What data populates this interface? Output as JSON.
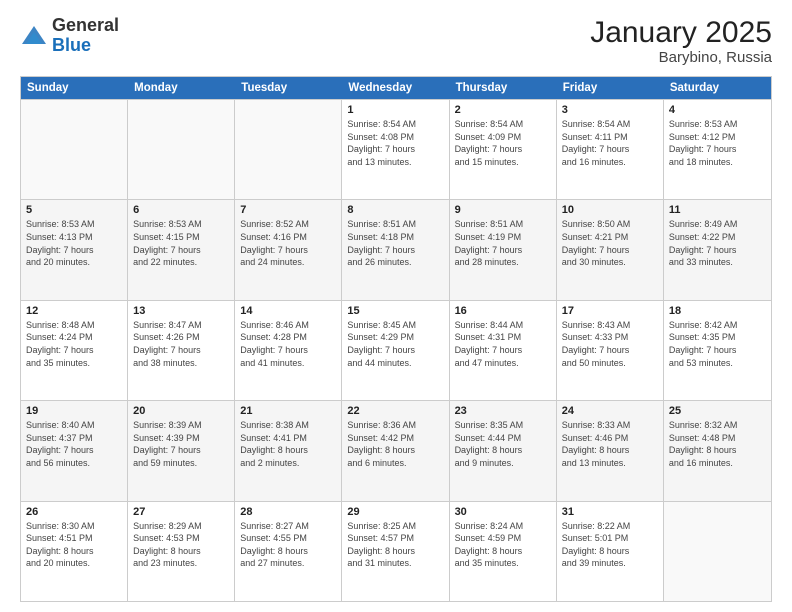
{
  "logo": {
    "general": "General",
    "blue": "Blue"
  },
  "title": "January 2025",
  "subtitle": "Barybino, Russia",
  "weekdays": [
    "Sunday",
    "Monday",
    "Tuesday",
    "Wednesday",
    "Thursday",
    "Friday",
    "Saturday"
  ],
  "rows": [
    [
      {
        "day": "",
        "info": "",
        "empty": true
      },
      {
        "day": "",
        "info": "",
        "empty": true
      },
      {
        "day": "",
        "info": "",
        "empty": true
      },
      {
        "day": "1",
        "info": "Sunrise: 8:54 AM\nSunset: 4:08 PM\nDaylight: 7 hours\nand 13 minutes.",
        "empty": false
      },
      {
        "day": "2",
        "info": "Sunrise: 8:54 AM\nSunset: 4:09 PM\nDaylight: 7 hours\nand 15 minutes.",
        "empty": false
      },
      {
        "day": "3",
        "info": "Sunrise: 8:54 AM\nSunset: 4:11 PM\nDaylight: 7 hours\nand 16 minutes.",
        "empty": false
      },
      {
        "day": "4",
        "info": "Sunrise: 8:53 AM\nSunset: 4:12 PM\nDaylight: 7 hours\nand 18 minutes.",
        "empty": false
      }
    ],
    [
      {
        "day": "5",
        "info": "Sunrise: 8:53 AM\nSunset: 4:13 PM\nDaylight: 7 hours\nand 20 minutes.",
        "empty": false,
        "alt": true
      },
      {
        "day": "6",
        "info": "Sunrise: 8:53 AM\nSunset: 4:15 PM\nDaylight: 7 hours\nand 22 minutes.",
        "empty": false,
        "alt": true
      },
      {
        "day": "7",
        "info": "Sunrise: 8:52 AM\nSunset: 4:16 PM\nDaylight: 7 hours\nand 24 minutes.",
        "empty": false,
        "alt": true
      },
      {
        "day": "8",
        "info": "Sunrise: 8:51 AM\nSunset: 4:18 PM\nDaylight: 7 hours\nand 26 minutes.",
        "empty": false,
        "alt": true
      },
      {
        "day": "9",
        "info": "Sunrise: 8:51 AM\nSunset: 4:19 PM\nDaylight: 7 hours\nand 28 minutes.",
        "empty": false,
        "alt": true
      },
      {
        "day": "10",
        "info": "Sunrise: 8:50 AM\nSunset: 4:21 PM\nDaylight: 7 hours\nand 30 minutes.",
        "empty": false,
        "alt": true
      },
      {
        "day": "11",
        "info": "Sunrise: 8:49 AM\nSunset: 4:22 PM\nDaylight: 7 hours\nand 33 minutes.",
        "empty": false,
        "alt": true
      }
    ],
    [
      {
        "day": "12",
        "info": "Sunrise: 8:48 AM\nSunset: 4:24 PM\nDaylight: 7 hours\nand 35 minutes.",
        "empty": false
      },
      {
        "day": "13",
        "info": "Sunrise: 8:47 AM\nSunset: 4:26 PM\nDaylight: 7 hours\nand 38 minutes.",
        "empty": false
      },
      {
        "day": "14",
        "info": "Sunrise: 8:46 AM\nSunset: 4:28 PM\nDaylight: 7 hours\nand 41 minutes.",
        "empty": false
      },
      {
        "day": "15",
        "info": "Sunrise: 8:45 AM\nSunset: 4:29 PM\nDaylight: 7 hours\nand 44 minutes.",
        "empty": false
      },
      {
        "day": "16",
        "info": "Sunrise: 8:44 AM\nSunset: 4:31 PM\nDaylight: 7 hours\nand 47 minutes.",
        "empty": false
      },
      {
        "day": "17",
        "info": "Sunrise: 8:43 AM\nSunset: 4:33 PM\nDaylight: 7 hours\nand 50 minutes.",
        "empty": false
      },
      {
        "day": "18",
        "info": "Sunrise: 8:42 AM\nSunset: 4:35 PM\nDaylight: 7 hours\nand 53 minutes.",
        "empty": false
      }
    ],
    [
      {
        "day": "19",
        "info": "Sunrise: 8:40 AM\nSunset: 4:37 PM\nDaylight: 7 hours\nand 56 minutes.",
        "empty": false,
        "alt": true
      },
      {
        "day": "20",
        "info": "Sunrise: 8:39 AM\nSunset: 4:39 PM\nDaylight: 7 hours\nand 59 minutes.",
        "empty": false,
        "alt": true
      },
      {
        "day": "21",
        "info": "Sunrise: 8:38 AM\nSunset: 4:41 PM\nDaylight: 8 hours\nand 2 minutes.",
        "empty": false,
        "alt": true
      },
      {
        "day": "22",
        "info": "Sunrise: 8:36 AM\nSunset: 4:42 PM\nDaylight: 8 hours\nand 6 minutes.",
        "empty": false,
        "alt": true
      },
      {
        "day": "23",
        "info": "Sunrise: 8:35 AM\nSunset: 4:44 PM\nDaylight: 8 hours\nand 9 minutes.",
        "empty": false,
        "alt": true
      },
      {
        "day": "24",
        "info": "Sunrise: 8:33 AM\nSunset: 4:46 PM\nDaylight: 8 hours\nand 13 minutes.",
        "empty": false,
        "alt": true
      },
      {
        "day": "25",
        "info": "Sunrise: 8:32 AM\nSunset: 4:48 PM\nDaylight: 8 hours\nand 16 minutes.",
        "empty": false,
        "alt": true
      }
    ],
    [
      {
        "day": "26",
        "info": "Sunrise: 8:30 AM\nSunset: 4:51 PM\nDaylight: 8 hours\nand 20 minutes.",
        "empty": false
      },
      {
        "day": "27",
        "info": "Sunrise: 8:29 AM\nSunset: 4:53 PM\nDaylight: 8 hours\nand 23 minutes.",
        "empty": false
      },
      {
        "day": "28",
        "info": "Sunrise: 8:27 AM\nSunset: 4:55 PM\nDaylight: 8 hours\nand 27 minutes.",
        "empty": false
      },
      {
        "day": "29",
        "info": "Sunrise: 8:25 AM\nSunset: 4:57 PM\nDaylight: 8 hours\nand 31 minutes.",
        "empty": false
      },
      {
        "day": "30",
        "info": "Sunrise: 8:24 AM\nSunset: 4:59 PM\nDaylight: 8 hours\nand 35 minutes.",
        "empty": false
      },
      {
        "day": "31",
        "info": "Sunrise: 8:22 AM\nSunset: 5:01 PM\nDaylight: 8 hours\nand 39 minutes.",
        "empty": false
      },
      {
        "day": "",
        "info": "",
        "empty": true
      }
    ]
  ]
}
